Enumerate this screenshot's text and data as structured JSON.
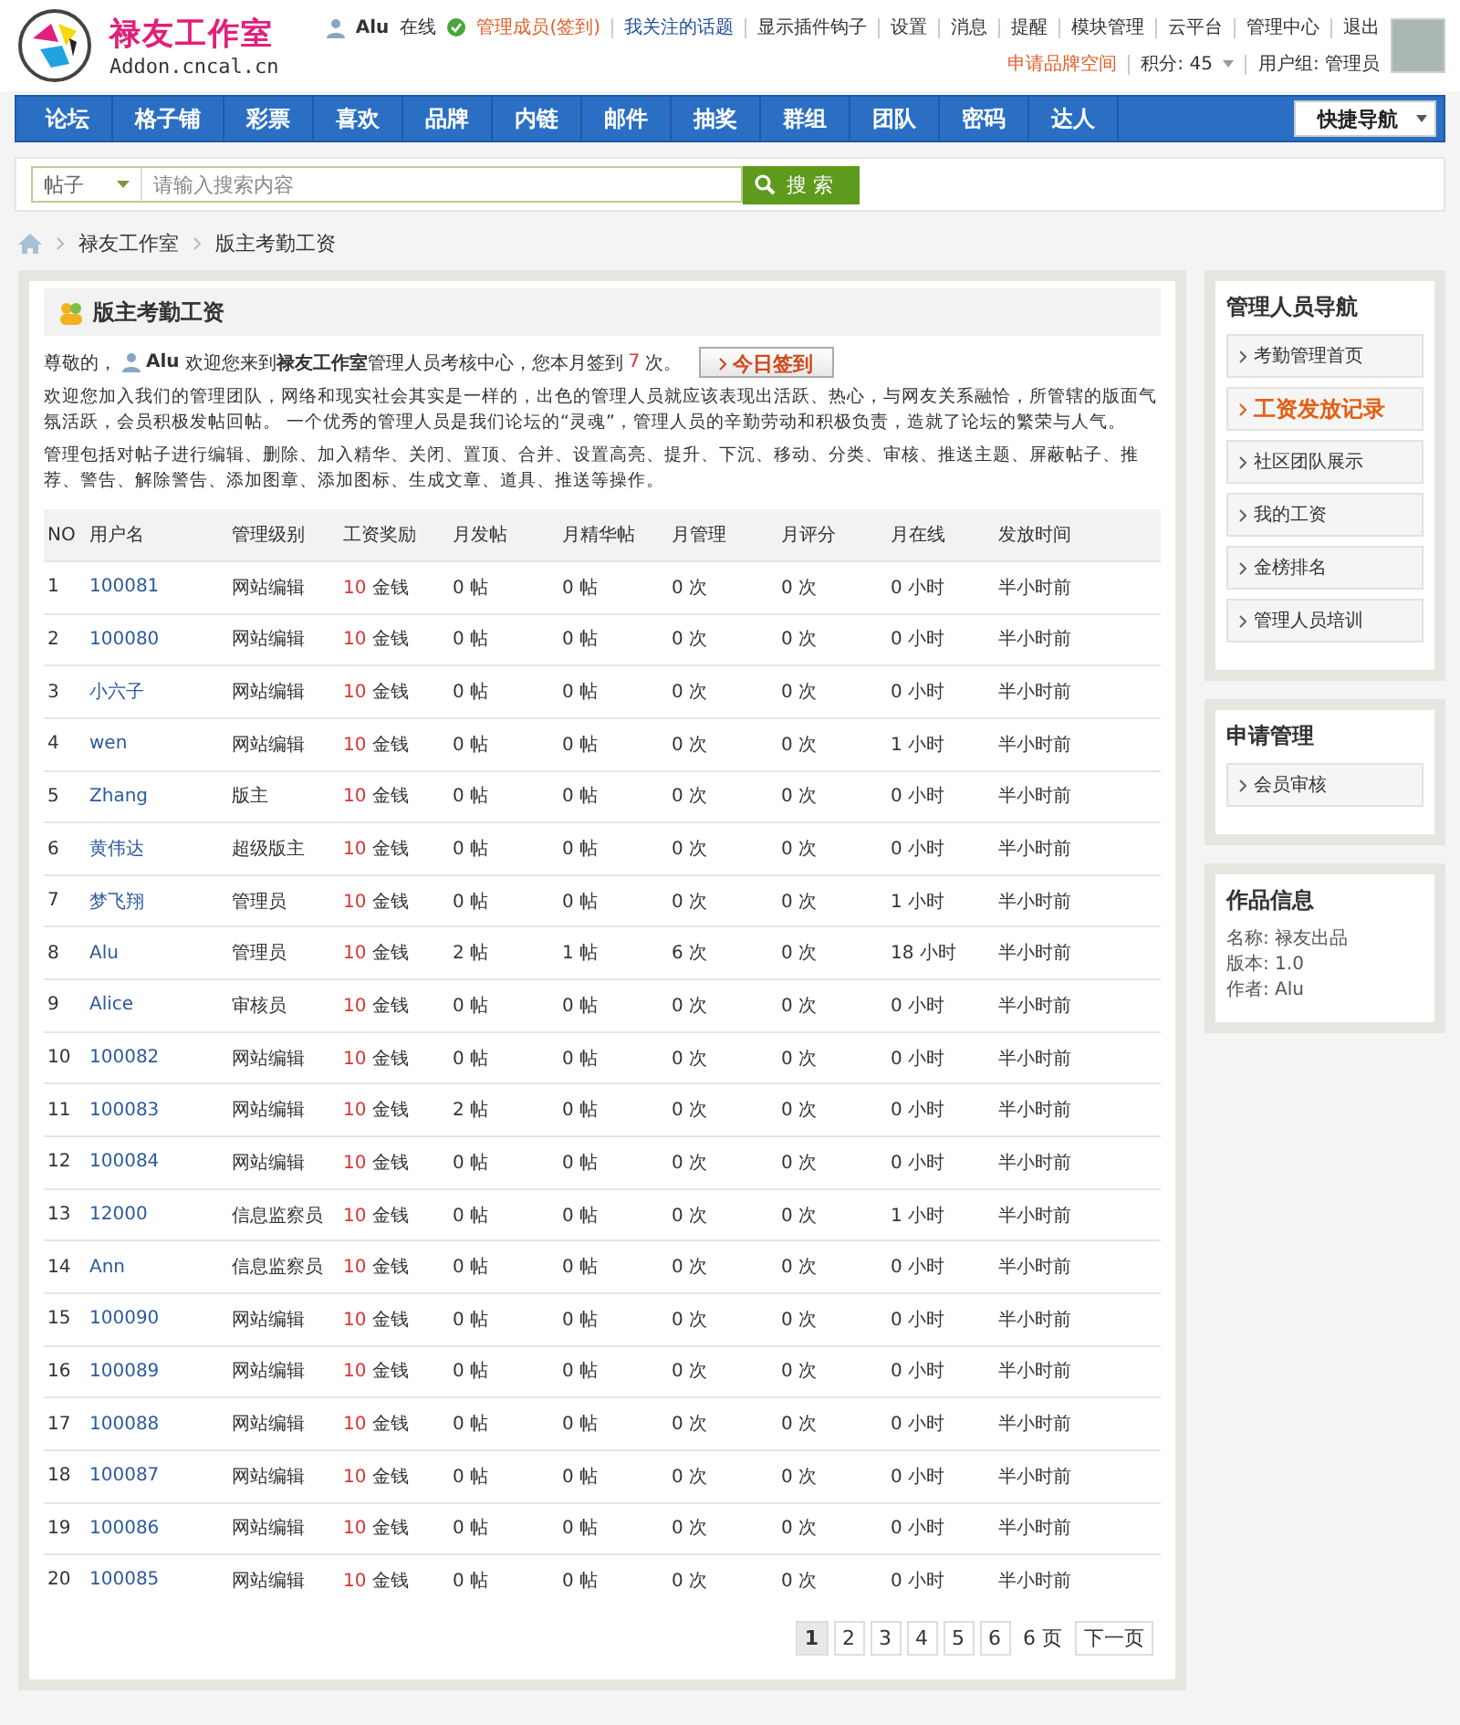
{
  "site": {
    "name": "禄友工作室",
    "domain": "Addon.cncal.cn"
  },
  "user_bar": {
    "user": "Alu",
    "status": "在线",
    "member": "管理成员(签到)",
    "follow": "我关注的话题",
    "links": [
      "显示插件钩子",
      "设置",
      "消息",
      "提醒",
      "模块管理",
      "云平台",
      "管理中心",
      "退出"
    ],
    "apply": "申请品牌空间",
    "points": "积分: 45",
    "group": "用户组: 管理员"
  },
  "nav": {
    "items": [
      "论坛",
      "格子铺",
      "彩票",
      "喜欢",
      "品牌",
      "内链",
      "邮件",
      "抽奖",
      "群组",
      "团队",
      "密码",
      "达人"
    ],
    "quick": "快捷导航"
  },
  "search": {
    "type": "帖子",
    "placeholder": "请输入搜索内容",
    "button": "搜 索"
  },
  "breadcrumb": [
    "禄友工作室",
    "版主考勤工资"
  ],
  "panel": {
    "title": "版主考勤工资",
    "greeting": "尊敬的，",
    "user": "Alu",
    "welcome": "欢迎您来到**禄友工作室**管理人员考核中心，您本月签到",
    "count": "7",
    "count_suffix": "次。",
    "checkin": "今日签到",
    "paragraphs": [
      "欢迎您加入我们的管理团队，网络和现实社会其实是一样的，出色的管理人员就应该表现出活跃、热心，与网友关系融恰，所管辖的版面气氛活跃，会员积极发帖回帖。 一个优秀的管理人员是我们论坛的“灵魂”，管理人员的辛勤劳动和积极负责，造就了论坛的繁荣与人气。",
      "管理包括对帖子进行编辑、删除、加入精华、关闭、置顶、合并、设置高亮、提升、下沉、移动、分类、审核、推送主题、屏蔽帖子、推荐、警告、解除警告、添加图章、添加图标、生成文章、道具、推送等操作。"
    ]
  },
  "table": {
    "columns": [
      "NO",
      "用户名",
      "管理级别",
      "工资奖励",
      "月发帖",
      "月精华帖",
      "月管理",
      "月评分",
      "月在线",
      "发放时间"
    ],
    "rows": [
      {
        "no": "1",
        "user": "100081",
        "role": "网站编辑",
        "wage": "10",
        "unit": "金钱",
        "posts": "0 帖",
        "digests": "0 帖",
        "manage": "0 次",
        "rating": "0 次",
        "online": "0 小时",
        "time": "半小时前"
      },
      {
        "no": "2",
        "user": "100080",
        "role": "网站编辑",
        "wage": "10",
        "unit": "金钱",
        "posts": "0 帖",
        "digests": "0 帖",
        "manage": "0 次",
        "rating": "0 次",
        "online": "0 小时",
        "time": "半小时前"
      },
      {
        "no": "3",
        "user": "小六子",
        "role": "网站编辑",
        "wage": "10",
        "unit": "金钱",
        "posts": "0 帖",
        "digests": "0 帖",
        "manage": "0 次",
        "rating": "0 次",
        "online": "0 小时",
        "time": "半小时前"
      },
      {
        "no": "4",
        "user": "wen",
        "role": "网站编辑",
        "wage": "10",
        "unit": "金钱",
        "posts": "0 帖",
        "digests": "0 帖",
        "manage": "0 次",
        "rating": "0 次",
        "online": "1 小时",
        "time": "半小时前"
      },
      {
        "no": "5",
        "user": "Zhang",
        "role": "版主",
        "wage": "10",
        "unit": "金钱",
        "posts": "0 帖",
        "digests": "0 帖",
        "manage": "0 次",
        "rating": "0 次",
        "online": "0 小时",
        "time": "半小时前"
      },
      {
        "no": "6",
        "user": "黄伟达",
        "role": "超级版主",
        "wage": "10",
        "unit": "金钱",
        "posts": "0 帖",
        "digests": "0 帖",
        "manage": "0 次",
        "rating": "0 次",
        "online": "0 小时",
        "time": "半小时前"
      },
      {
        "no": "7",
        "user": "梦飞翔",
        "role": "管理员",
        "wage": "10",
        "unit": "金钱",
        "posts": "0 帖",
        "digests": "0 帖",
        "manage": "0 次",
        "rating": "0 次",
        "online": "1 小时",
        "time": "半小时前"
      },
      {
        "no": "8",
        "user": "Alu",
        "role": "管理员",
        "wage": "10",
        "unit": "金钱",
        "posts": "2 帖",
        "digests": "1 帖",
        "manage": "6 次",
        "rating": "0 次",
        "online": "18 小时",
        "time": "半小时前"
      },
      {
        "no": "9",
        "user": "Alice",
        "role": "审核员",
        "wage": "10",
        "unit": "金钱",
        "posts": "0 帖",
        "digests": "0 帖",
        "manage": "0 次",
        "rating": "0 次",
        "online": "0 小时",
        "time": "半小时前"
      },
      {
        "no": "10",
        "user": "100082",
        "role": "网站编辑",
        "wage": "10",
        "unit": "金钱",
        "posts": "0 帖",
        "digests": "0 帖",
        "manage": "0 次",
        "rating": "0 次",
        "online": "0 小时",
        "time": "半小时前"
      },
      {
        "no": "11",
        "user": "100083",
        "role": "网站编辑",
        "wage": "10",
        "unit": "金钱",
        "posts": "2 帖",
        "digests": "0 帖",
        "manage": "0 次",
        "rating": "0 次",
        "online": "0 小时",
        "time": "半小时前"
      },
      {
        "no": "12",
        "user": "100084",
        "role": "网站编辑",
        "wage": "10",
        "unit": "金钱",
        "posts": "0 帖",
        "digests": "0 帖",
        "manage": "0 次",
        "rating": "0 次",
        "online": "0 小时",
        "time": "半小时前"
      },
      {
        "no": "13",
        "user": "12000",
        "role": "信息监察员",
        "wage": "10",
        "unit": "金钱",
        "posts": "0 帖",
        "digests": "0 帖",
        "manage": "0 次",
        "rating": "0 次",
        "online": "1 小时",
        "time": "半小时前"
      },
      {
        "no": "14",
        "user": "Ann",
        "role": "信息监察员",
        "wage": "10",
        "unit": "金钱",
        "posts": "0 帖",
        "digests": "0 帖",
        "manage": "0 次",
        "rating": "0 次",
        "online": "0 小时",
        "time": "半小时前"
      },
      {
        "no": "15",
        "user": "100090",
        "role": "网站编辑",
        "wage": "10",
        "unit": "金钱",
        "posts": "0 帖",
        "digests": "0 帖",
        "manage": "0 次",
        "rating": "0 次",
        "online": "0 小时",
        "time": "半小时前"
      },
      {
        "no": "16",
        "user": "100089",
        "role": "网站编辑",
        "wage": "10",
        "unit": "金钱",
        "posts": "0 帖",
        "digests": "0 帖",
        "manage": "0 次",
        "rating": "0 次",
        "online": "0 小时",
        "time": "半小时前"
      },
      {
        "no": "17",
        "user": "100088",
        "role": "网站编辑",
        "wage": "10",
        "unit": "金钱",
        "posts": "0 帖",
        "digests": "0 帖",
        "manage": "0 次",
        "rating": "0 次",
        "online": "0 小时",
        "time": "半小时前"
      },
      {
        "no": "18",
        "user": "100087",
        "role": "网站编辑",
        "wage": "10",
        "unit": "金钱",
        "posts": "0 帖",
        "digests": "0 帖",
        "manage": "0 次",
        "rating": "0 次",
        "online": "0 小时",
        "time": "半小时前"
      },
      {
        "no": "19",
        "user": "100086",
        "role": "网站编辑",
        "wage": "10",
        "unit": "金钱",
        "posts": "0 帖",
        "digests": "0 帖",
        "manage": "0 次",
        "rating": "0 次",
        "online": "0 小时",
        "time": "半小时前"
      },
      {
        "no": "20",
        "user": "100085",
        "role": "网站编辑",
        "wage": "10",
        "unit": "金钱",
        "posts": "0 帖",
        "digests": "0 帖",
        "manage": "0 次",
        "rating": "0 次",
        "online": "0 小时",
        "time": "半小时前"
      }
    ]
  },
  "pagination": {
    "pages": [
      {
        "label": "1",
        "selected": true
      },
      {
        "label": "2",
        "selected": false
      },
      {
        "label": "3",
        "selected": false
      },
      {
        "label": "4",
        "selected": false
      },
      {
        "label": "5",
        "selected": false
      },
      {
        "label": "6",
        "selected": false
      }
    ],
    "total": "6 页",
    "next": "下一页"
  },
  "sidebar": [
    {
      "title": "管理人员导航",
      "items": [
        {
          "label": "考勤管理首页",
          "selected": false
        },
        {
          "label": "工资发放记录",
          "selected": true
        },
        {
          "label": "社区团队展示",
          "selected": false
        },
        {
          "label": "我的工资",
          "selected": false
        },
        {
          "label": "金榜排名",
          "selected": false
        },
        {
          "label": "管理人员培训",
          "selected": false
        }
      ]
    },
    {
      "title": "申请管理",
      "items": [
        {
          "label": "会员审核",
          "selected": false
        }
      ]
    },
    {
      "title": "作品信息",
      "lines": [
        "名称: 禄友出品",
        "版本: 1.0",
        "作者: Alu"
      ]
    }
  ]
}
